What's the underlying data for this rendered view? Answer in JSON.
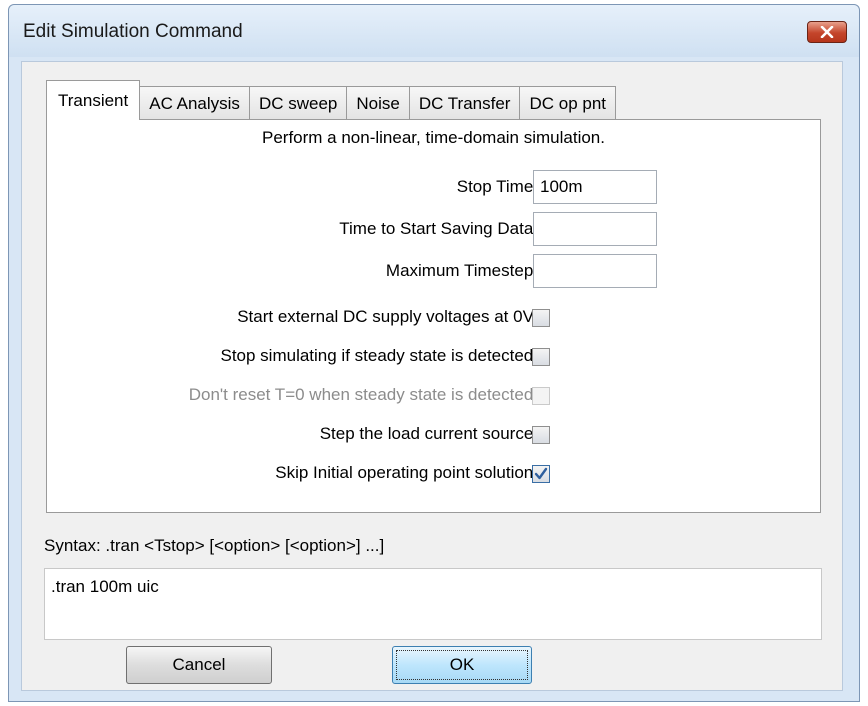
{
  "window": {
    "title": "Edit Simulation Command"
  },
  "tabs": [
    {
      "label": "Transient",
      "active": true
    },
    {
      "label": "AC Analysis"
    },
    {
      "label": "DC sweep"
    },
    {
      "label": "Noise"
    },
    {
      "label": "DC Transfer"
    },
    {
      "label": "DC op pnt"
    }
  ],
  "transient": {
    "description": "Perform a non-linear, time-domain simulation.",
    "stop_time": {
      "label": "Stop Time:",
      "value": "100m"
    },
    "start_saving": {
      "label": "Time to Start Saving Data:",
      "value": ""
    },
    "max_timestep": {
      "label": "Maximum Timestep:",
      "value": ""
    },
    "options": [
      {
        "label": "Start external DC supply voltages at 0V:",
        "checked": false,
        "enabled": true
      },
      {
        "label": "Stop simulating if steady state is detected:",
        "checked": false,
        "enabled": true
      },
      {
        "label": "Don't reset T=0 when steady state is detected:",
        "checked": false,
        "enabled": false
      },
      {
        "label": "Step the load current source:",
        "checked": false,
        "enabled": true
      },
      {
        "label": "Skip Initial operating point solution:",
        "checked": true,
        "enabled": true
      }
    ]
  },
  "syntax": "Syntax:  .tran <Tstop> [<option> [<option>] ...]",
  "command_text": ".tran 100m uic",
  "buttons": {
    "cancel": "Cancel",
    "ok": "OK"
  },
  "icons": {
    "close": "close-icon",
    "check": "check-icon"
  },
  "colors": {
    "titlebar": "#d8e6f5",
    "close": "#c4452b",
    "check": "#2f5f9e"
  }
}
